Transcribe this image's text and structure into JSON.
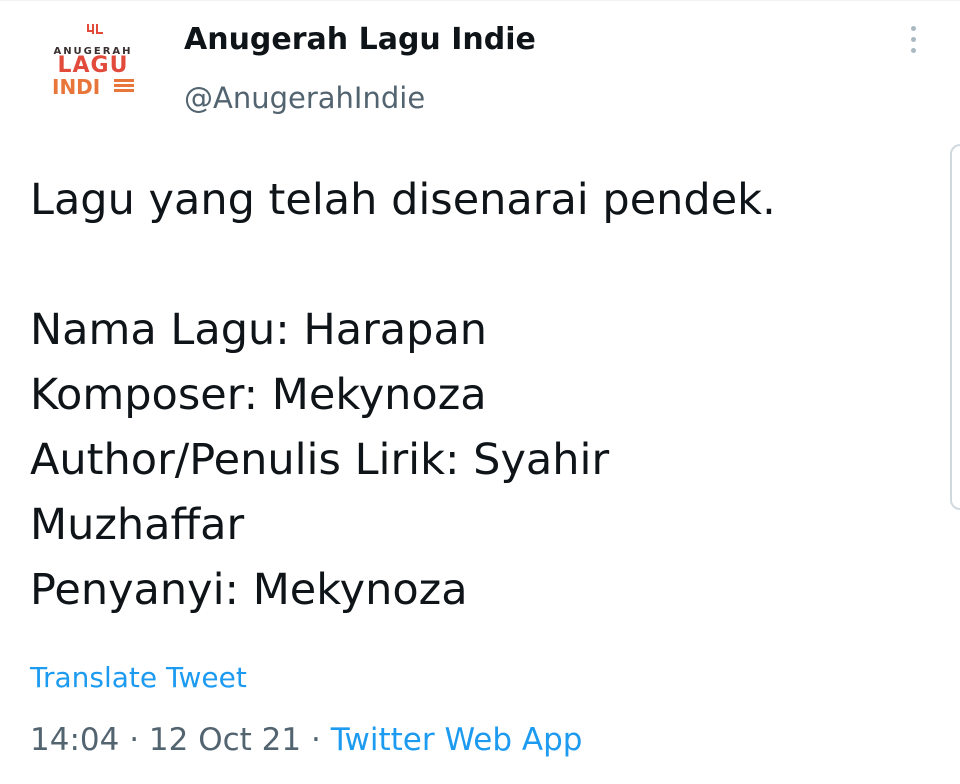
{
  "account": {
    "display_name": "Anugerah Lagu Indie",
    "handle": "@AnugerahIndie",
    "avatar": {
      "icon": "anugerah-lagu-indie-logo",
      "mark_text": "4L",
      "top_text": "ANUGERAH",
      "mid_text": "LAGU",
      "bottom_text": "INDI",
      "colors": {
        "mid": "#e24a3b",
        "bottom": "#e8763a",
        "top": "#3a2f2f"
      }
    }
  },
  "more_menu": {
    "icon": "more-vertical-icon"
  },
  "tweet": {
    "lines": [
      "Lagu yang telah disenarai pendek.",
      "",
      "Nama Lagu: Harapan",
      "Komposer: Mekynoza",
      "Author/Penulis Lirik: Syahir",
      "Muzhaffar",
      "Penyanyi: Mekynoza"
    ]
  },
  "translate_label": "Translate Tweet",
  "meta": {
    "time": "14:04",
    "separator": "·",
    "date": "12 Oct 21",
    "source": "Twitter Web App"
  },
  "colors": {
    "link": "#1d9bf0",
    "secondary_text": "#536471",
    "primary_text": "#0f1419"
  }
}
